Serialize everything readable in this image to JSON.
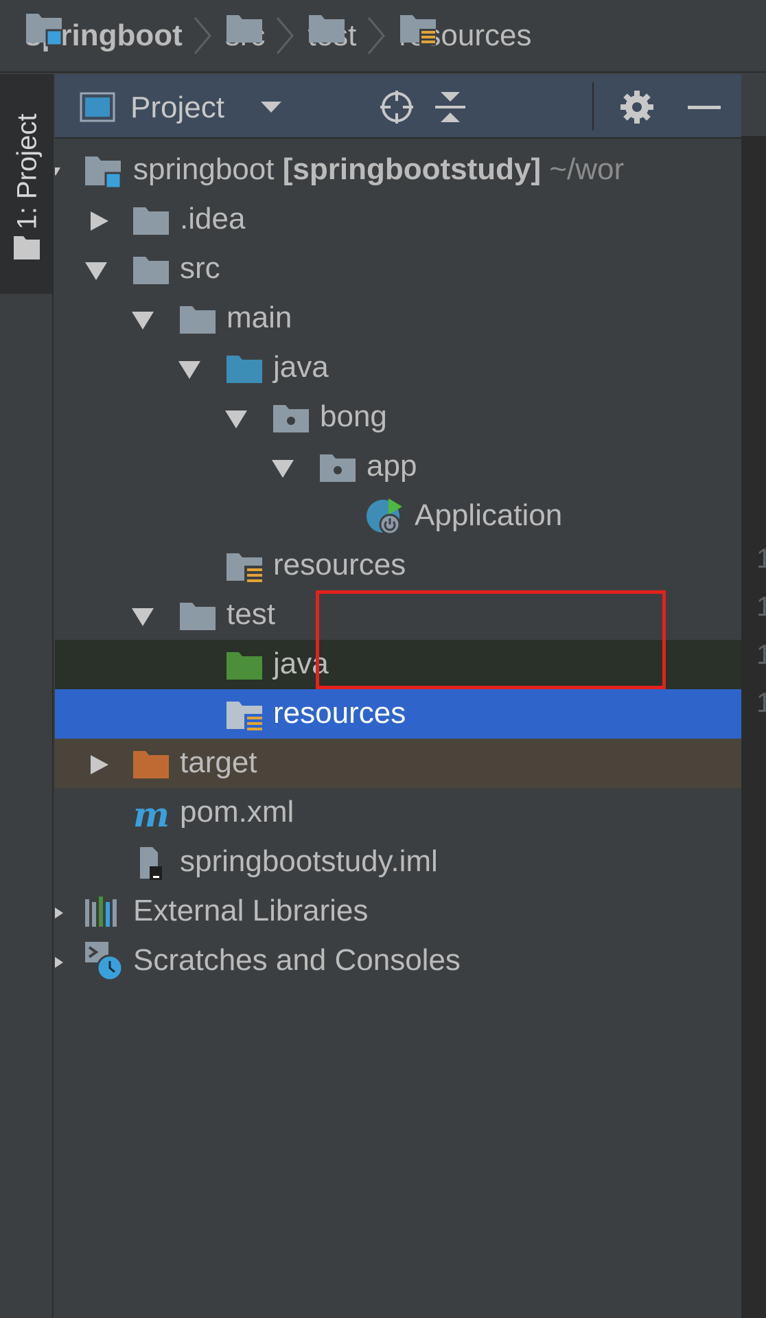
{
  "breadcrumb": {
    "items": [
      "springboot",
      "src",
      "test",
      "resources"
    ]
  },
  "side_stripe": {
    "tab_label": "1: Project"
  },
  "panel": {
    "view_label": "Project",
    "buttons": [
      "locate-icon",
      "collapse-all-icon",
      "gear-icon",
      "minimize-icon"
    ]
  },
  "tree": {
    "root": {
      "name": "springboot",
      "module": "[springbootstudy]",
      "path": "~/wor"
    },
    "idea": ".idea",
    "src": "src",
    "main": "main",
    "main_java": "java",
    "bong": "bong",
    "app": "app",
    "application": "Application",
    "main_resources": "resources",
    "test": "test",
    "test_java": "java",
    "test_resources": "resources",
    "target": "target",
    "pom": "pom.xml",
    "iml": "springbootstudy.iml",
    "external_libraries": "External Libraries",
    "scratches": "Scratches and Consoles"
  },
  "gutter": [
    "1",
    "1",
    "1",
    "1"
  ],
  "colors": {
    "background": "#3c3f41",
    "header": "#3d4b5c",
    "selection": "#2f65ca",
    "test_row": "#293128",
    "excluded_row": "#4a443a",
    "highlight_box": "#e3221d",
    "folder": "#8c9aa6",
    "source_folder": "#3d8eb6",
    "test_folder": "#4b8f3a",
    "excluded_folder": "#c06a33"
  }
}
